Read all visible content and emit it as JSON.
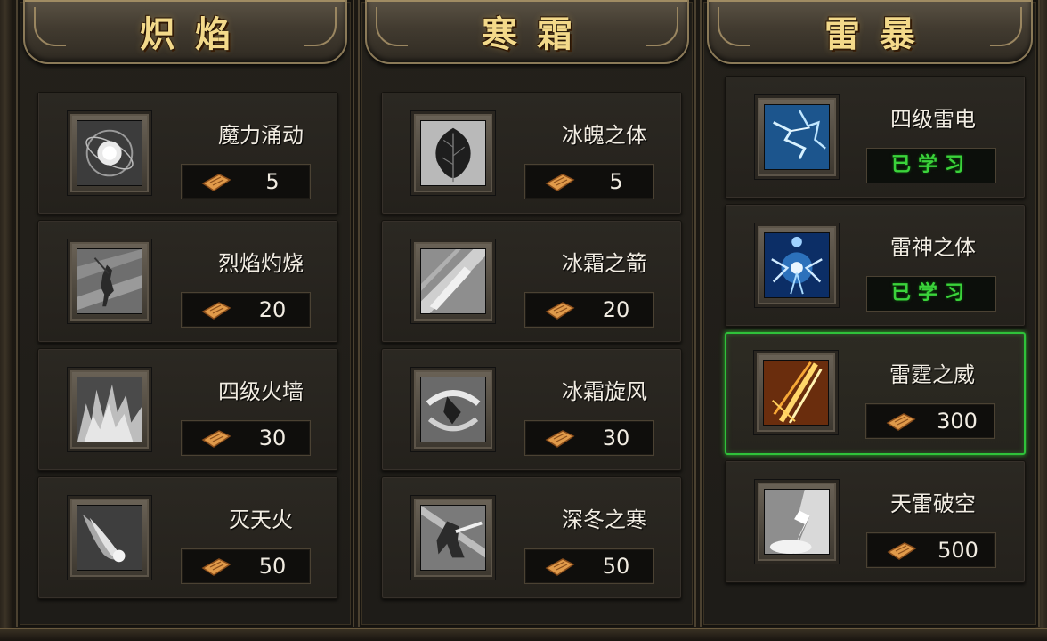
{
  "columns": [
    {
      "title": "炽焰",
      "skills": [
        {
          "name": "魔力涌动",
          "cost": "5",
          "learned": false,
          "icon": "orb-icon"
        },
        {
          "name": "烈焰灼烧",
          "cost": "20",
          "learned": false,
          "icon": "mage-silhouette-icon"
        },
        {
          "name": "四级火墙",
          "cost": "30",
          "learned": false,
          "icon": "fire-wall-icon"
        },
        {
          "name": "灭天火",
          "cost": "50",
          "learned": false,
          "icon": "meteor-icon"
        }
      ]
    },
    {
      "title": "寒霜",
      "skills": [
        {
          "name": "冰魄之体",
          "cost": "5",
          "learned": false,
          "icon": "leaf-icon"
        },
        {
          "name": "冰霜之箭",
          "cost": "20",
          "learned": false,
          "icon": "frost-arrow-icon"
        },
        {
          "name": "冰霜旋风",
          "cost": "30",
          "learned": false,
          "icon": "whirlwind-icon"
        },
        {
          "name": "深冬之寒",
          "cost": "50",
          "learned": false,
          "icon": "frost-warrior-icon"
        }
      ]
    },
    {
      "title": "雷暴",
      "skills": [
        {
          "name": "四级雷电",
          "cost": "已学习",
          "learned": true,
          "icon": "lightning-icon"
        },
        {
          "name": "雷神之体",
          "cost": "已学习",
          "learned": true,
          "icon": "thunder-god-icon"
        },
        {
          "name": "雷霆之威",
          "cost": "300",
          "learned": false,
          "selected": true,
          "icon": "thunder-strike-icon"
        },
        {
          "name": "天雷破空",
          "cost": "500",
          "learned": false,
          "icon": "sky-thunder-icon"
        }
      ]
    }
  ],
  "colors": {
    "selected_border": "#2fc23a",
    "learned_text": "#3bd33b",
    "title_gold": "#f3d98a"
  }
}
